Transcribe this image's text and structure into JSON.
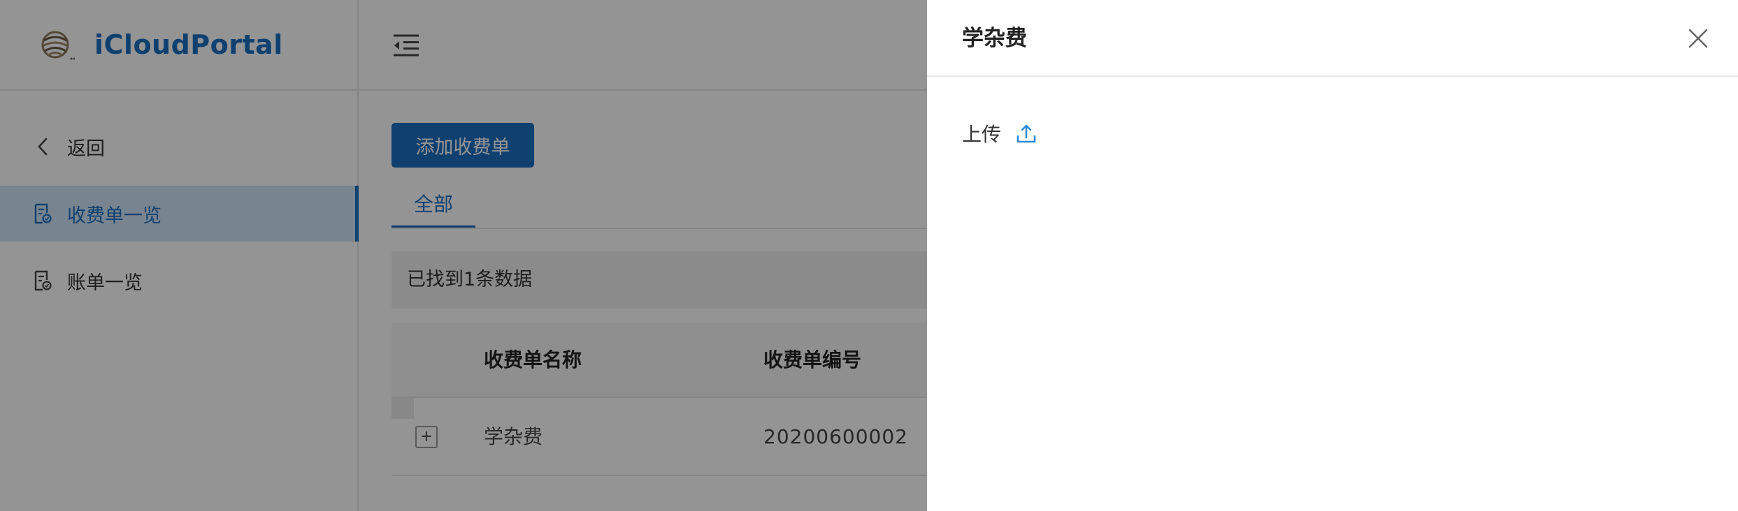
{
  "logo": {
    "text": "iCloudPortal",
    "brand_color": "#1b6fc0"
  },
  "sidebar": {
    "items": [
      {
        "label": "返回",
        "icon": "chevron-left-icon"
      },
      {
        "label": "收费单一览",
        "icon": "receipt-icon",
        "active": true
      },
      {
        "label": "账单一览",
        "icon": "receipt-icon"
      }
    ]
  },
  "toolbar": {
    "menu_icon": "menu-collapse-icon",
    "add_label": "添加收费单"
  },
  "tabs": [
    {
      "label": "全部",
      "active": true
    }
  ],
  "results": {
    "found_text": "已找到1条数据"
  },
  "table": {
    "columns": [
      "收费单名称",
      "收费单编号"
    ],
    "rows": [
      {
        "name": "学杂费",
        "code": "20200600002"
      }
    ]
  },
  "drawer": {
    "title": "学杂费",
    "upload_label": "上传",
    "upload_icon": "upload-icon",
    "close_icon": "close-icon"
  },
  "colors": {
    "accent": "#1b6fc0",
    "overlay": "rgba(0,0,0,0.42)"
  }
}
